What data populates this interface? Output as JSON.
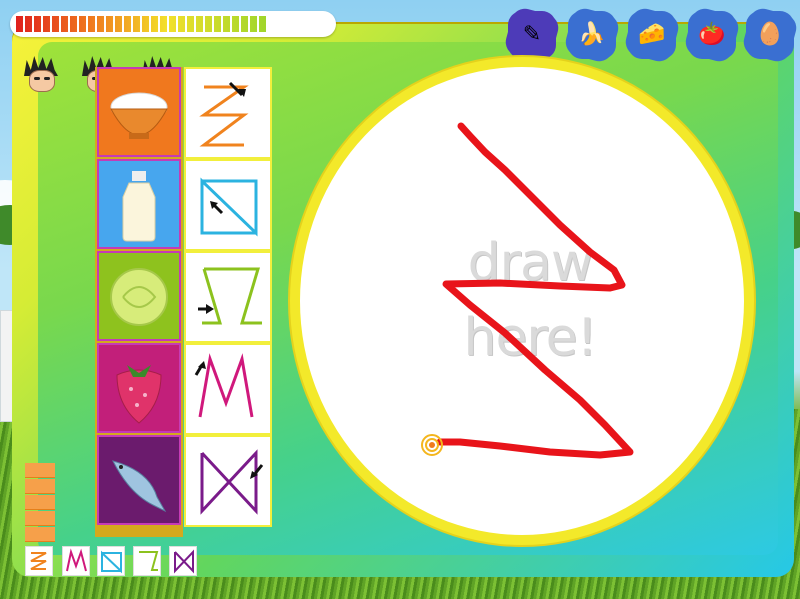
{
  "hud": {
    "progress_value": 0.78,
    "colors": {
      "red": "#e0201d",
      "orange": "#f07a1e",
      "yellow": "#f3e02a",
      "green": "#9fd62a"
    }
  },
  "categories": [
    {
      "icon": "palette-icon",
      "color": "#4d3bb8",
      "glyph": "✎"
    },
    {
      "icon": "banana-icon",
      "color": "#3a6fd1",
      "glyph": "🍌"
    },
    {
      "icon": "cheese-icon",
      "color": "#3a6fd1",
      "glyph": "🧀"
    },
    {
      "icon": "tomato-icon",
      "color": "#3a6fd1",
      "glyph": "🍅"
    },
    {
      "icon": "eggs-icon",
      "color": "#3a6fd1",
      "glyph": "🥚"
    }
  ],
  "players": [
    "player-avatar-1",
    "player-avatar-2",
    "player-avatar-3"
  ],
  "foods": [
    {
      "name": "rice",
      "icon": "rice-bowl-icon",
      "bg": "#f0781e"
    },
    {
      "name": "milk",
      "icon": "milk-bottle-icon",
      "bg": "#47a6ee"
    },
    {
      "name": "lettuce",
      "icon": "lettuce-icon",
      "bg": "#8ec21e"
    },
    {
      "name": "strawberry",
      "icon": "strawberry-icon",
      "bg": "#c21f7a"
    },
    {
      "name": "fish",
      "icon": "fish-icon",
      "bg": "#6b1b6d"
    }
  ],
  "patterns": [
    {
      "name": "zigzag-z",
      "color": "#f0831e"
    },
    {
      "name": "triangle-slash",
      "color": "#2bb3e0"
    },
    {
      "name": "trapezoid",
      "color": "#8cc21e"
    },
    {
      "name": "m-shape",
      "color": "#d0187c"
    },
    {
      "name": "bowtie-x",
      "color": "#7a1b8a"
    }
  ],
  "canvas": {
    "hint_line1": "draw",
    "hint_line2": "here!",
    "stroke_color": "#e8141a"
  },
  "meter": {
    "filled_segments": 5
  },
  "selection_bar": [
    {
      "pattern": "zigzag-z",
      "color": "#f0831e"
    },
    {
      "pattern": "m-shape",
      "color": "#d0187c"
    },
    {
      "pattern": "triangle-slash",
      "color": "#2bb3e0"
    },
    {
      "pattern": "trapezoid",
      "color": "#8cc21e"
    },
    {
      "pattern": "bowtie-x",
      "color": "#7a1b8a"
    }
  ]
}
